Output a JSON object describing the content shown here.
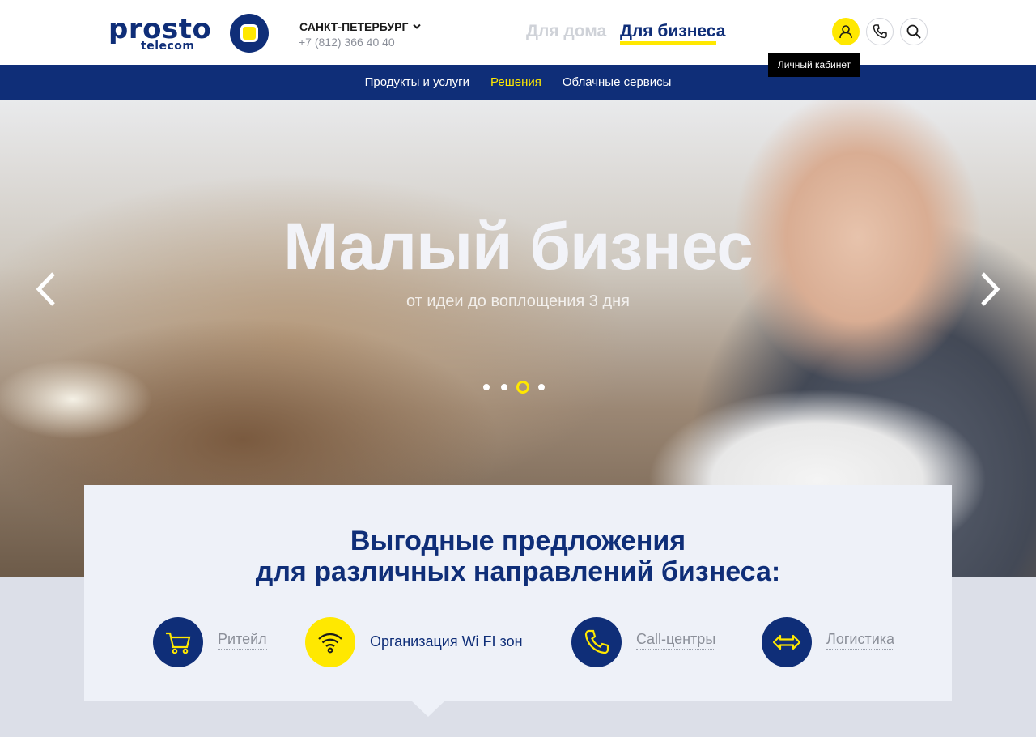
{
  "header": {
    "logo_text": "prosto",
    "logo_sub": "telecom",
    "city": "САНКТ-ПЕТЕРБУРГ",
    "phone": "+7 (812) 366 40 40",
    "segments": {
      "home": "Для дома",
      "business": "Для бизнеса"
    },
    "icons": {
      "user": "user-icon",
      "call": "phone-icon",
      "search": "search-icon"
    },
    "tooltip": "Личный кабинет"
  },
  "nav": {
    "items": [
      {
        "label": "Продукты и услуги",
        "active": false
      },
      {
        "label": "Решения",
        "active": true
      },
      {
        "label": "Облачные сервисы",
        "active": false
      }
    ]
  },
  "hero": {
    "title": "Малый бизнес",
    "subtitle": "от идеи до воплощения 3 дня",
    "slides_total": 4,
    "active_slide": 3
  },
  "offers": {
    "title_line1": "Выгодные предложения",
    "title_line2": "для различных направлений бизнеса:",
    "items": [
      {
        "label": "Ритейл",
        "icon": "cart-icon"
      },
      {
        "label": "Организация Wi FI зон",
        "icon": "wifi-icon"
      },
      {
        "label": "Call-центры",
        "icon": "phone-icon"
      },
      {
        "label": "Логистика",
        "icon": "arrows-icon"
      }
    ]
  },
  "colors": {
    "brand_blue": "#0f2e78",
    "accent_yellow": "#ffe800",
    "muted_gray": "#8b8f99"
  }
}
